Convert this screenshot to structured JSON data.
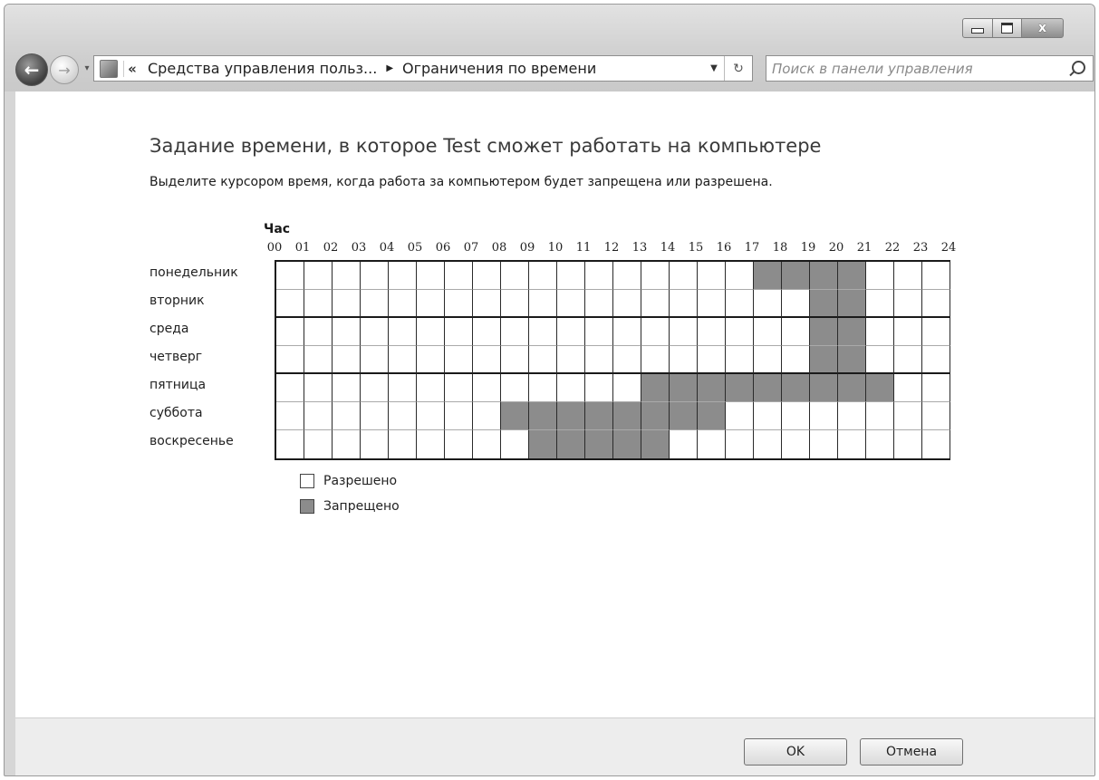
{
  "window": {
    "caption_buttons": {
      "minimize_icon": "minimize-icon",
      "maximize_icon": "maximize-icon",
      "close_icon": "close-icon",
      "close_glyph": "x"
    }
  },
  "navigation": {
    "back_icon": "back-arrow-icon",
    "forward_icon": "forward-arrow-icon",
    "back_glyph": "←",
    "forward_glyph": "→",
    "history_glyph": "▾"
  },
  "address_bar": {
    "overflow_glyph": "«",
    "separator_glyph": "▶",
    "breadcrumbs": [
      "Средства управления польз...",
      "Ограничения по времени"
    ],
    "dropdown_glyph": "▼",
    "refresh_glyph": "↻"
  },
  "search": {
    "placeholder": "Поиск в панели управления",
    "value": ""
  },
  "page": {
    "title": "Задание времени, в которое Test сможет работать на компьютере",
    "instruction": "Выделите курсором время, когда работа за компьютером будет запрещена или разрешена."
  },
  "schedule": {
    "hour_caption": "Час",
    "hours": [
      "00",
      "01",
      "02",
      "03",
      "04",
      "05",
      "06",
      "07",
      "08",
      "09",
      "10",
      "11",
      "12",
      "13",
      "14",
      "15",
      "16",
      "17",
      "18",
      "19",
      "20",
      "21",
      "22",
      "23",
      "24"
    ],
    "days": [
      "понедельник",
      "вторник",
      "среда",
      "четверг",
      "пятница",
      "суббота",
      "воскресенье"
    ],
    "blocked": [
      [
        17,
        18,
        19,
        20
      ],
      [
        19,
        20
      ],
      [
        19,
        20
      ],
      [
        19,
        20
      ],
      [
        13,
        14,
        15,
        16,
        17,
        18,
        19,
        20,
        21
      ],
      [
        8,
        9,
        10,
        11,
        12,
        13,
        14,
        15
      ],
      [
        9,
        10,
        11,
        12,
        13
      ]
    ]
  },
  "legend": {
    "allowed": "Разрешено",
    "blocked": "Запрещено",
    "allowed_color": "#ffffff",
    "blocked_color": "#8c8c8c"
  },
  "footer": {
    "ok_label": "OK",
    "cancel_label": "Отмена"
  }
}
